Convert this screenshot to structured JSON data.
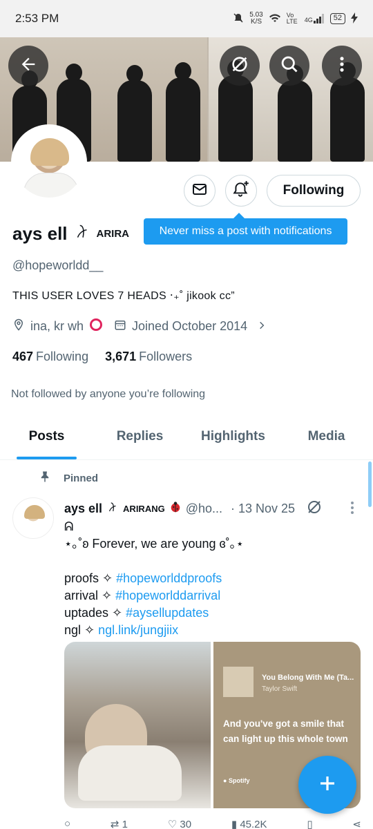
{
  "status_bar": {
    "time": "2:53 PM",
    "speed_value": "5.03",
    "speed_unit": "K/S",
    "network": "Vo LTE",
    "signal": "4G",
    "battery": "52"
  },
  "banner": {
    "back_label": "back",
    "translate_label": "grok",
    "search_label": "search",
    "more_label": "more"
  },
  "profile": {
    "name": "ays ell",
    "badge_text": "ARIRA",
    "handle": "@hopeworldd__",
    "bio": "THIS USER LOVES 7 HEADS ‧₊˚ jikook cc”",
    "location": "ina, kr wh",
    "joined": "Joined October 2014",
    "following_count": "467",
    "following_label": "Following",
    "followers_count": "3,671",
    "followers_label": "Followers",
    "not_followed": "Not followed by anyone you’re following",
    "follow_button": "Following"
  },
  "tooltip": {
    "text": "Never miss a post with notifications"
  },
  "tabs": [
    {
      "label": "Posts",
      "active": true
    },
    {
      "label": "Replies",
      "active": false
    },
    {
      "label": "Highlights",
      "active": false
    },
    {
      "label": "Media",
      "active": false
    }
  ],
  "post": {
    "pinned_label": "Pinned",
    "author": "ays ell",
    "author_sub": "ARIRANG",
    "handle": "@ho...",
    "date": "· 13 Nov 25",
    "line_extra": "ᕱ",
    "line1": "⋆｡˚ʚ Forever, we are young ɞ˚｡⋆",
    "line2_prefix": "proofs ✧",
    "line2_link": "#hopeworlddproofs",
    "line3_prefix": "arrival ✧",
    "line3_link": "#hopeworlddarrival",
    "line4_prefix": "uptades ✧",
    "line4_link": "#aysellupdates",
    "line5_prefix": "ngl ✧",
    "line5_link": "ngl.link/jungjiix",
    "media_song": "You Belong With Me (Ta...",
    "media_artist": "Taylor Swift",
    "media_lyric": "And you've got a smile that can light up this whole town",
    "media_spotify": "Spotify",
    "reply_count": "",
    "repost_count": "1",
    "like_count": "30",
    "views_count": "45.2K"
  },
  "colors": {
    "accent": "#1d9bf0",
    "text": "#0f1419",
    "secondary": "#536471"
  }
}
